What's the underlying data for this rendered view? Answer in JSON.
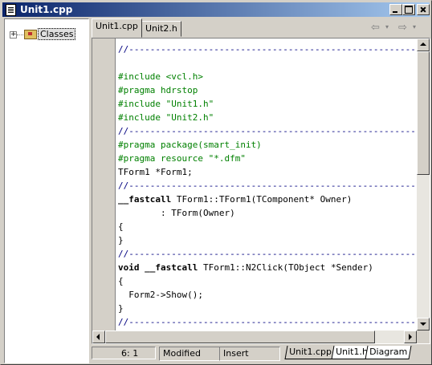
{
  "window": {
    "title": "Unit1.cpp"
  },
  "tree": {
    "root_label": "Classes",
    "expander": "+"
  },
  "tabs": [
    {
      "label": "Unit1.cpp",
      "active": true
    },
    {
      "label": "Unit2.h",
      "active": false
    }
  ],
  "nav": {
    "back_icon": "arrow-left-icon",
    "forward_icon": "arrow-right-icon"
  },
  "code_lines": [
    "//---------------------------------------------------------------------------",
    "",
    "#include <vcl.h>",
    "#pragma hdrstop",
    "#include \"Unit1.h\"",
    "#include \"Unit2.h\"",
    "//---------------------------------------------------------------------------",
    "#pragma package(smart_init)",
    "#pragma resource \"*.dfm\"",
    "TForm1 *Form1;",
    "//---------------------------------------------------------------------------",
    "__fastcall TForm1::TForm1(TComponent* Owner)",
    "        : TForm(Owner)",
    "{",
    "}",
    "//---------------------------------------------------------------------------",
    "void __fastcall TForm1::N2Click(TObject *Sender)",
    "{",
    "  Form2->Show();",
    "}",
    "//---------------------------------------------------------------------------"
  ],
  "status": {
    "position": "6:   1",
    "modified": "Modified",
    "insert_mode": "Insert",
    "bottom_tabs": [
      "Unit1.cpp",
      "Unit1.h",
      "Diagram"
    ]
  },
  "colors": {
    "title_bar": "#0a246a",
    "comment": "#000080",
    "preprocessor": "#008000"
  }
}
